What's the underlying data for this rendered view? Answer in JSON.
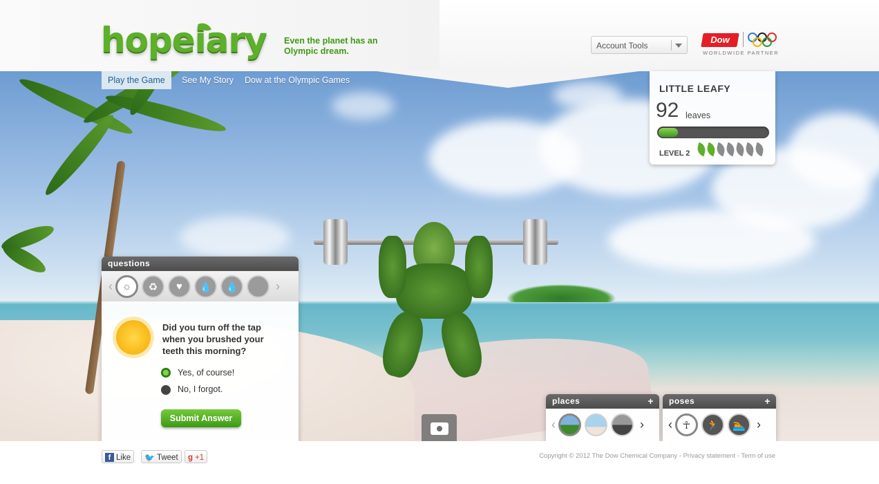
{
  "brand": {
    "logo_text": "hopeiary",
    "tagline": "Even the planet has an Olympic dream."
  },
  "header": {
    "account_tools_label": "Account Tools",
    "partner_name": "Dow",
    "partner_subtitle": "WORLDWIDE PARTNER"
  },
  "nav": {
    "tabs": [
      {
        "label": "Play the Game",
        "active": true
      },
      {
        "label": "See My Story",
        "active": false
      },
      {
        "label": "Dow at the Olympic Games",
        "active": false
      }
    ]
  },
  "character": {
    "name": "LITTLE LEAFY",
    "leaves_count": "92",
    "leaves_unit": "leaves",
    "progress_fraction": 0.18,
    "level_label": "LEVEL 2",
    "level_leaves_filled": 2,
    "level_leaves_total": 7
  },
  "questions": {
    "title": "questions",
    "icons": [
      "sun-icon",
      "recycle-icon",
      "heart-icon",
      "water-drop-icon",
      "water-drop-icon",
      "blank-icon"
    ],
    "question_text": "Did you turn off the tap when you brushed your teeth this morning?",
    "options": [
      {
        "label": "Yes, of course!",
        "selected": true
      },
      {
        "label": "No, I forgot.",
        "selected": false
      }
    ],
    "submit_label": "Submit Answer"
  },
  "places": {
    "title": "places",
    "plus": "+"
  },
  "poses": {
    "title": "poses",
    "plus": "+"
  },
  "footer": {
    "social": {
      "like": "Like",
      "tweet": "Tweet",
      "plusone": "+1"
    },
    "copyright": "Copyright © 2012 The Dow Chemical Company - Privacy statement - Term of use"
  },
  "colors": {
    "brand_green": "#5cb02a",
    "dow_red": "#e41e26",
    "tab_active": "#1d5f94"
  }
}
